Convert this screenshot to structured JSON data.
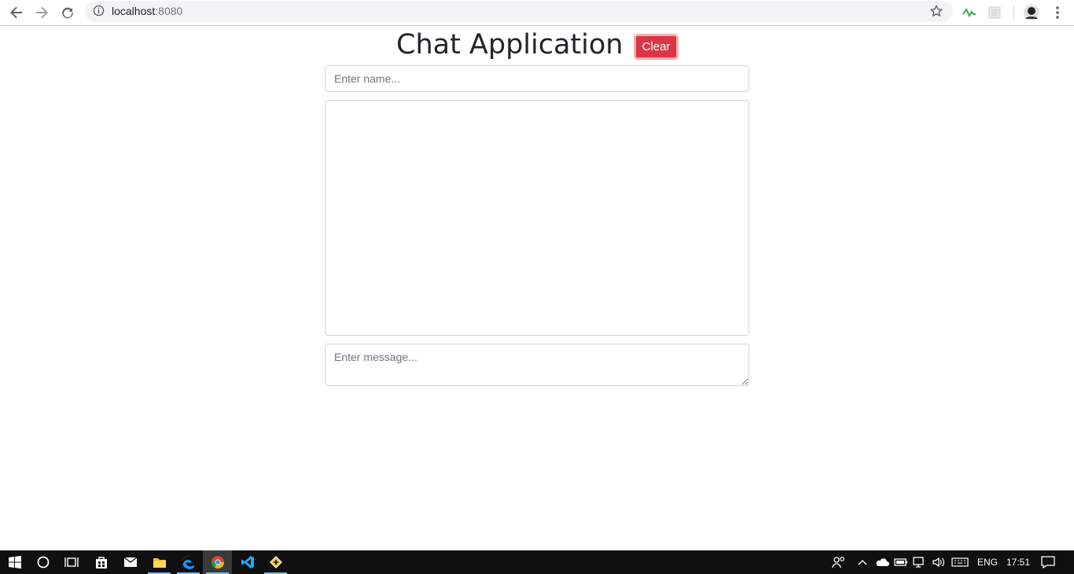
{
  "browser": {
    "url_host": "localhost",
    "url_port": ":8080"
  },
  "page": {
    "title": "Chat Application",
    "clear_label": "Clear",
    "name_placeholder": "Enter name...",
    "message_placeholder": "Enter message..."
  },
  "taskbar": {
    "language": "ENG",
    "time": "17:51"
  },
  "colors": {
    "danger": "#dc3545",
    "taskbar": "#101010",
    "active_underline": "#76b9ed"
  }
}
